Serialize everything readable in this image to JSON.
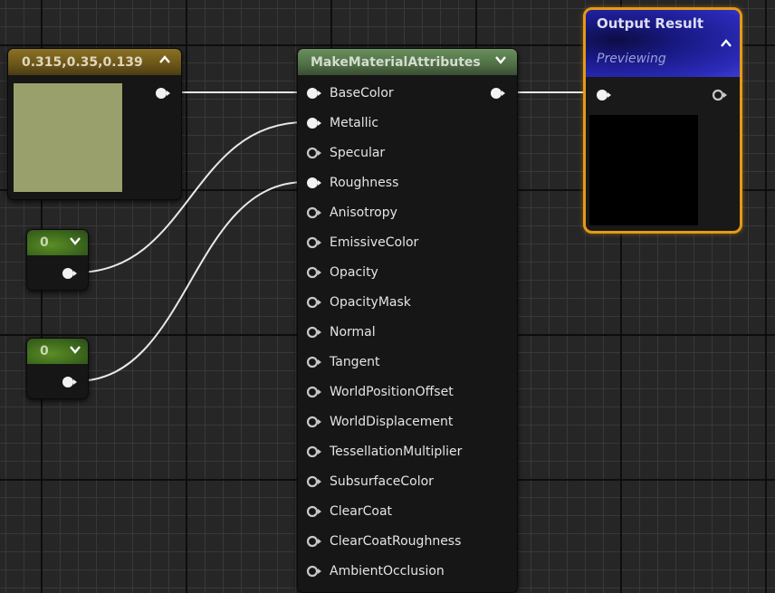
{
  "graph": {
    "constant3_node": {
      "title": "0.315,0.35,0.139",
      "color_value": [
        0.315,
        0.35,
        0.139
      ],
      "swatch_color": "#9aa06b",
      "collapse_icon": "chevron-up-icon"
    },
    "constant_nodes": [
      {
        "value": "0",
        "expand_icon": "chevron-down-icon"
      },
      {
        "value": "0",
        "expand_icon": "chevron-down-icon"
      }
    ],
    "make_material_node": {
      "title": "MakeMaterialAttributes",
      "expand_icon": "chevron-down-icon",
      "inputs": [
        {
          "label": "BaseColor",
          "connected": true
        },
        {
          "label": "Metallic",
          "connected": true
        },
        {
          "label": "Specular",
          "connected": false
        },
        {
          "label": "Roughness",
          "connected": true
        },
        {
          "label": "Anisotropy",
          "connected": false
        },
        {
          "label": "EmissiveColor",
          "connected": false
        },
        {
          "label": "Opacity",
          "connected": false
        },
        {
          "label": "OpacityMask",
          "connected": false
        },
        {
          "label": "Normal",
          "connected": false
        },
        {
          "label": "Tangent",
          "connected": false
        },
        {
          "label": "WorldPositionOffset",
          "connected": false
        },
        {
          "label": "WorldDisplacement",
          "connected": false
        },
        {
          "label": "TessellationMultiplier",
          "connected": false
        },
        {
          "label": "SubsurfaceColor",
          "connected": false
        },
        {
          "label": "ClearCoat",
          "connected": false
        },
        {
          "label": "ClearCoatRoughness",
          "connected": false
        },
        {
          "label": "AmbientOcclusion",
          "connected": false
        }
      ]
    },
    "output_node": {
      "title": "Output Result",
      "subtitle": "Previewing",
      "collapse_icon": "chevron-up-icon",
      "highlight_color": "#e59a16",
      "preview_color": "#000000"
    },
    "connections": [
      {
        "from": "constant3.output",
        "to": "make_material.BaseColor"
      },
      {
        "from": "constant_1.output",
        "to": "make_material.Metallic"
      },
      {
        "from": "constant_2.output",
        "to": "make_material.Roughness"
      },
      {
        "from": "make_material.output",
        "to": "output_result.input"
      }
    ]
  }
}
